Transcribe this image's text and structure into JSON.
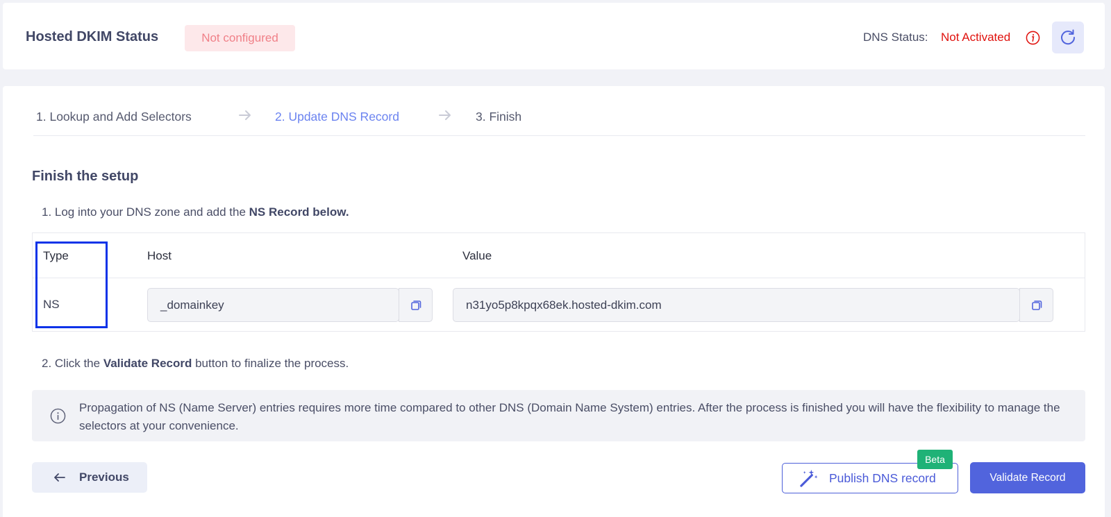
{
  "header": {
    "title": "Hosted DKIM Status",
    "status_badge": "Not configured",
    "dns_status_label": "DNS Status:",
    "dns_status_value": "Not Activated"
  },
  "steps": [
    {
      "label": "1. Lookup and Add Selectors",
      "state": "done"
    },
    {
      "label": "2. Update DNS Record",
      "state": "active"
    },
    {
      "label": "3. Finish",
      "state": "pending"
    }
  ],
  "setup": {
    "title": "Finish the setup",
    "instruction_1_prefix": "1. Log into your DNS zone and add the ",
    "instruction_1_bold": "NS Record below.",
    "instruction_2_prefix": "2. Click the ",
    "instruction_2_bold": "Validate Record",
    "instruction_2_suffix": " button to finalize the process."
  },
  "record_table": {
    "headers": {
      "type": "Type",
      "host": "Host",
      "value": "Value"
    },
    "row": {
      "type": "NS",
      "host": "_domainkey",
      "value": "n31yo5p8kpqx68ek.hosted-dkim.com"
    }
  },
  "info": {
    "text": "Propagation of NS (Name Server) entries requires more time compared to other DNS (Domain Name System) entries. After the process is finished you will have the flexibility to manage the selectors at your convenience."
  },
  "actions": {
    "previous": "Previous",
    "publish": "Publish DNS record",
    "beta": "Beta",
    "validate": "Validate Record"
  },
  "colors": {
    "accent": "#5164dd",
    "active_step": "#6b83f0",
    "error": "#e0120e",
    "badge_bg": "#fde8ea",
    "beta": "#1fb277",
    "highlight_border": "#0b33e8"
  },
  "icons": [
    "info-icon",
    "refresh-icon",
    "chevron-right-icon",
    "copy-icon",
    "arrow-left-icon",
    "magic-wand-icon"
  ]
}
